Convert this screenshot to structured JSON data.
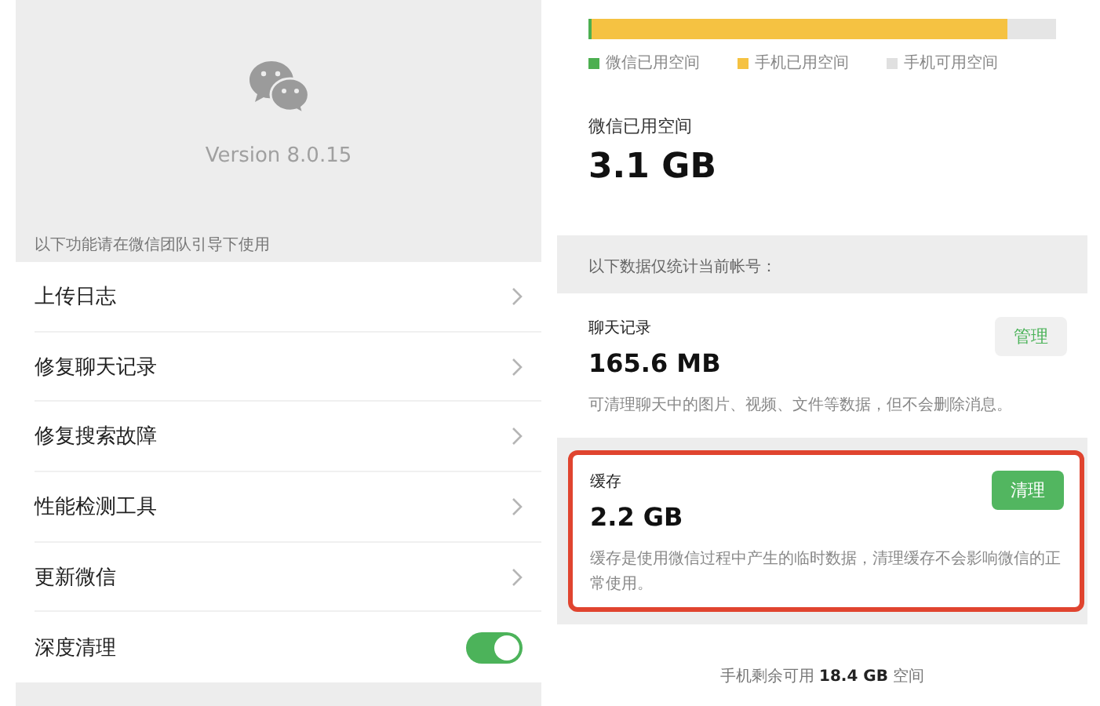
{
  "left": {
    "version": "Version 8.0.15",
    "section_note": "以下功能请在微信团队引导下使用",
    "items": [
      {
        "kind": "link",
        "label": "上传日志"
      },
      {
        "kind": "link",
        "label": "修复聊天记录"
      },
      {
        "kind": "link",
        "label": "修复搜索故障"
      },
      {
        "kind": "link",
        "label": "性能检测工具"
      },
      {
        "kind": "link",
        "label": "更新微信"
      },
      {
        "kind": "toggle",
        "label": "深度清理",
        "on": true
      }
    ]
  },
  "right": {
    "storage_bar": [
      {
        "level": 0.006,
        "color": "#4caf50"
      },
      {
        "level": 0.89,
        "color": "#f5c242"
      }
    ],
    "legend": [
      {
        "label": "微信已用空间",
        "color": "#4caf50"
      },
      {
        "label": "手机已用空间",
        "color": "#f5c242"
      },
      {
        "label": "手机可用空间",
        "color": "#e0e0e0"
      }
    ],
    "used_label": "微信已用空间",
    "used_value": "3.1 GB",
    "account_note": "以下数据仅统计当前帐号：",
    "cards": [
      {
        "title": "聊天记录",
        "size": "165.6 MB",
        "button": "管理",
        "primary": false,
        "highlighted": false,
        "description": "可清理聊天中的图片、视频、文件等数据，但不会删除消息。"
      },
      {
        "title": "缓存",
        "size": "2.2 GB",
        "button": "清理",
        "primary": true,
        "highlighted": true,
        "description": "缓存是使用微信过程中产生的临时数据，清理缓存不会影响微信的正常使用。"
      }
    ],
    "footer": "手机剩余可用 **18.4 GB** 空间"
  }
}
